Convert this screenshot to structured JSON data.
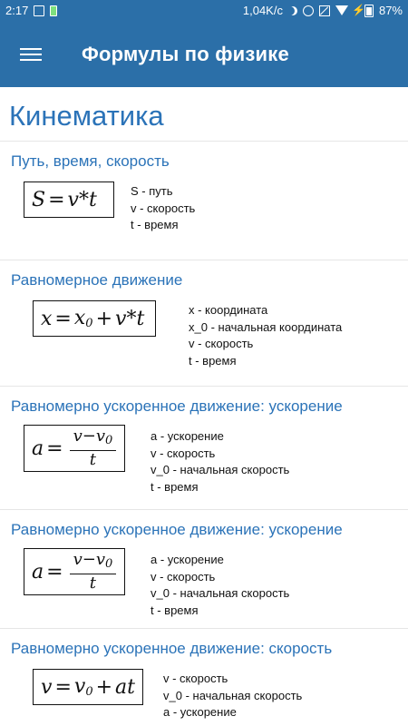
{
  "status_bar": {
    "time": "2:17",
    "network_speed": "1,04K/c",
    "battery": "87%"
  },
  "app_bar": {
    "title": "Формулы по физике"
  },
  "section": {
    "title": "Кинематика"
  },
  "cards": [
    {
      "title": "Путь, время, скорость",
      "formula": "S=v*t",
      "legend": [
        "S - путь",
        "v - скорость",
        "t - время"
      ]
    },
    {
      "title": "Равномерное движение",
      "formula": "x=x_0+v*t",
      "legend": [
        "x - координата",
        "x_0 - начальная координата",
        "v - скорость",
        "t - время"
      ]
    },
    {
      "title": "Равномерно ускоренное движение: ускорение",
      "formula": "a=(v-v_0)/t",
      "legend": [
        "a - ускорение",
        "v - скорость",
        "v_0 - начальная скорость",
        "t - время"
      ]
    },
    {
      "title": "Равномерно ускоренное движение: ускорение",
      "formula": "a=(v-v_0)/t",
      "legend": [
        "a - ускорение",
        "v - скорость",
        "v_0 - начальная скорость",
        "t - время"
      ]
    },
    {
      "title": "Равномерно ускоренное движение: скорость",
      "formula": "v=v_0+at",
      "legend": [
        "v - скорость",
        "v_0 - начальная скорость",
        "a - ускорение"
      ]
    }
  ],
  "icons": [
    "image-icon",
    "battery-saver-icon",
    "moon-icon",
    "alarm-icon",
    "sim-icon",
    "wifi-icon",
    "charging-icon",
    "battery-icon",
    "menu-icon"
  ],
  "colors": {
    "app_bar": "#2b6fa8",
    "title_blue": "#2b73b8"
  }
}
